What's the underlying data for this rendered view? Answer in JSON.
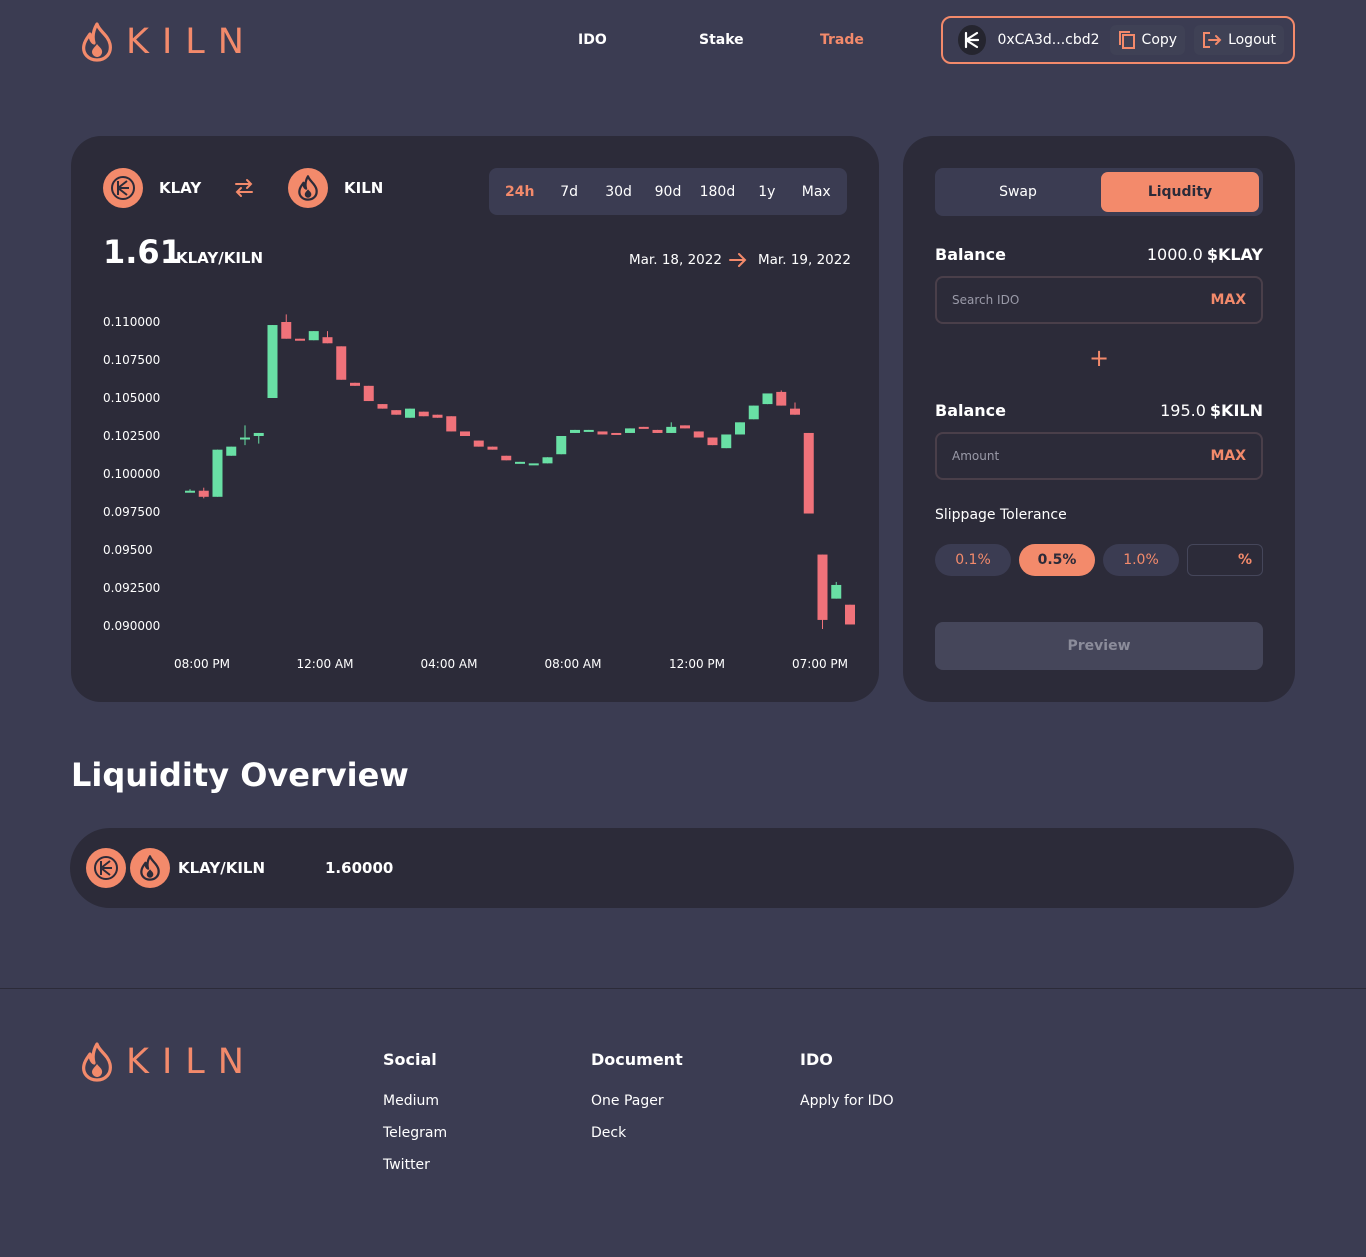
{
  "brand": {
    "name": "KILN",
    "accent": "#f38a6b"
  },
  "nav": {
    "ido": "IDO",
    "stake": "Stake",
    "trade": "Trade"
  },
  "wallet": {
    "address": "0xCA3d...cbd2",
    "copy": "Copy",
    "logout": "Logout"
  },
  "pair": {
    "base": "KLAY",
    "quote": "KILN"
  },
  "ranges": [
    "24h",
    "7d",
    "30d",
    "90d",
    "180d",
    "1y",
    "Max"
  ],
  "active_range": "24h",
  "price": {
    "value": "1.61",
    "pair": "KLAY/KILN"
  },
  "dates": {
    "from": "Mar. 18, 2022",
    "to": "Mar. 19, 2022"
  },
  "chart_data": {
    "type": "candlestick",
    "y_ticks": [
      "0.110000",
      "0.107500",
      "0.105000",
      "0.102500",
      "0.100000",
      "0.097500",
      "0.09500",
      "0.092500",
      "0.090000"
    ],
    "x_ticks": [
      "08:00 PM",
      "12:00 AM",
      "04:00 AM",
      "08:00 AM",
      "12:00 PM",
      "07:00 PM"
    ],
    "ylim": [
      0.09,
      0.11
    ],
    "up_color": "#69e0a5",
    "down_color": "#f0727a",
    "candles": [
      {
        "o": 0.0989,
        "c": 0.0989,
        "h": 0.099,
        "l": 0.0988
      },
      {
        "o": 0.0989,
        "c": 0.0985,
        "h": 0.0991,
        "l": 0.0984
      },
      {
        "o": 0.0985,
        "c": 0.1016,
        "h": 0.1016,
        "l": 0.0985
      },
      {
        "o": 0.1012,
        "c": 0.1018,
        "h": 0.1018,
        "l": 0.1012
      },
      {
        "o": 0.1023,
        "c": 0.1024,
        "h": 0.1032,
        "l": 0.1019
      },
      {
        "o": 0.1025,
        "c": 0.1027,
        "h": 0.1027,
        "l": 0.102
      },
      {
        "o": 0.105,
        "c": 0.1098,
        "h": 0.1098,
        "l": 0.105
      },
      {
        "o": 0.11,
        "c": 0.1089,
        "h": 0.1105,
        "l": 0.1089
      },
      {
        "o": 0.1089,
        "c": 0.1088,
        "h": 0.1089,
        "l": 0.1088
      },
      {
        "o": 0.1088,
        "c": 0.1094,
        "h": 0.1094,
        "l": 0.1088
      },
      {
        "o": 0.109,
        "c": 0.1086,
        "h": 0.1094,
        "l": 0.1086
      },
      {
        "o": 0.1084,
        "c": 0.1062,
        "h": 0.1084,
        "l": 0.1062
      },
      {
        "o": 0.106,
        "c": 0.1058,
        "h": 0.106,
        "l": 0.1058
      },
      {
        "o": 0.1058,
        "c": 0.1048,
        "h": 0.1058,
        "l": 0.1048
      },
      {
        "o": 0.1046,
        "c": 0.1043,
        "h": 0.1046,
        "l": 0.1043
      },
      {
        "o": 0.1042,
        "c": 0.1039,
        "h": 0.1042,
        "l": 0.1039
      },
      {
        "o": 0.1037,
        "c": 0.1043,
        "h": 0.1043,
        "l": 0.1037
      },
      {
        "o": 0.1041,
        "c": 0.1038,
        "h": 0.1041,
        "l": 0.1038
      },
      {
        "o": 0.1039,
        "c": 0.1037,
        "h": 0.1039,
        "l": 0.1037
      },
      {
        "o": 0.1038,
        "c": 0.1028,
        "h": 0.1038,
        "l": 0.1028
      },
      {
        "o": 0.1028,
        "c": 0.1025,
        "h": 0.1028,
        "l": 0.1025
      },
      {
        "o": 0.1022,
        "c": 0.1018,
        "h": 0.1022,
        "l": 0.1018
      },
      {
        "o": 0.1018,
        "c": 0.1016,
        "h": 0.1018,
        "l": 0.1016
      },
      {
        "o": 0.1012,
        "c": 0.1009,
        "h": 0.1012,
        "l": 0.1009
      },
      {
        "o": 0.1008,
        "c": 0.1008,
        "h": 0.1008,
        "l": 0.1007
      },
      {
        "o": 0.1007,
        "c": 0.1007,
        "h": 0.1007,
        "l": 0.1007
      },
      {
        "o": 0.1007,
        "c": 0.1011,
        "h": 0.1011,
        "l": 0.1007
      },
      {
        "o": 0.1013,
        "c": 0.1025,
        "h": 0.1025,
        "l": 0.1013
      },
      {
        "o": 0.1027,
        "c": 0.1029,
        "h": 0.1029,
        "l": 0.1027
      },
      {
        "o": 0.1028,
        "c": 0.1029,
        "h": 0.1029,
        "l": 0.1028
      },
      {
        "o": 0.1028,
        "c": 0.1026,
        "h": 0.1028,
        "l": 0.1026
      },
      {
        "o": 0.1027,
        "c": 0.1026,
        "h": 0.1027,
        "l": 0.1026
      },
      {
        "o": 0.1027,
        "c": 0.103,
        "h": 0.103,
        "l": 0.1027
      },
      {
        "o": 0.1031,
        "c": 0.103,
        "h": 0.1031,
        "l": 0.103
      },
      {
        "o": 0.1029,
        "c": 0.1027,
        "h": 0.1029,
        "l": 0.1027
      },
      {
        "o": 0.1027,
        "c": 0.1031,
        "h": 0.1034,
        "l": 0.1027
      },
      {
        "o": 0.1032,
        "c": 0.103,
        "h": 0.1032,
        "l": 0.103
      },
      {
        "o": 0.1028,
        "c": 0.1024,
        "h": 0.1028,
        "l": 0.1024
      },
      {
        "o": 0.1024,
        "c": 0.1019,
        "h": 0.1024,
        "l": 0.1019
      },
      {
        "o": 0.1017,
        "c": 0.1026,
        "h": 0.1026,
        "l": 0.1017
      },
      {
        "o": 0.1026,
        "c": 0.1034,
        "h": 0.1034,
        "l": 0.1026
      },
      {
        "o": 0.1036,
        "c": 0.1045,
        "h": 0.1045,
        "l": 0.1036
      },
      {
        "o": 0.1046,
        "c": 0.1053,
        "h": 0.1053,
        "l": 0.1046
      },
      {
        "o": 0.1054,
        "c": 0.1045,
        "h": 0.1055,
        "l": 0.1045
      },
      {
        "o": 0.1043,
        "c": 0.1039,
        "h": 0.1047,
        "l": 0.1039
      },
      {
        "o": 0.1027,
        "c": 0.0974,
        "h": 0.1027,
        "l": 0.0974
      },
      {
        "o": 0.0947,
        "c": 0.0904,
        "h": 0.0947,
        "l": 0.0898
      },
      {
        "o": 0.0918,
        "c": 0.0927,
        "h": 0.0929,
        "l": 0.0918
      },
      {
        "o": 0.0914,
        "c": 0.0901,
        "h": 0.0914,
        "l": 0.0901
      }
    ]
  },
  "trade": {
    "tabs": [
      "Swap",
      "Liqudity"
    ],
    "active_tab": "Liqudity",
    "balance_label": "Balance",
    "balance1": {
      "value": "1000.0",
      "unit": "$KLAY"
    },
    "input1_placeholder": "Search IDO",
    "max": "MAX",
    "plus": "+",
    "balance2": {
      "value": "195.0",
      "unit": "$KILN"
    },
    "input2_placeholder": "Amount",
    "slippage_label": "Slippage Tolerance",
    "slippage_options": [
      "0.1%",
      "0.5%",
      "1.0%"
    ],
    "slippage_active": "0.5%",
    "slippage_custom_suffix": "%",
    "preview": "Preview"
  },
  "overview": {
    "title": "Liquidity Overview",
    "rows": [
      {
        "pair": "KLAY/KILN",
        "value": "1.60000"
      }
    ]
  },
  "footer": {
    "social": {
      "title": "Social",
      "links": [
        "Medium",
        "Telegram",
        "Twitter"
      ]
    },
    "document": {
      "title": "Document",
      "links": [
        "One Pager",
        "Deck"
      ]
    },
    "ido": {
      "title": "IDO",
      "links": [
        "Apply for IDO"
      ]
    }
  }
}
